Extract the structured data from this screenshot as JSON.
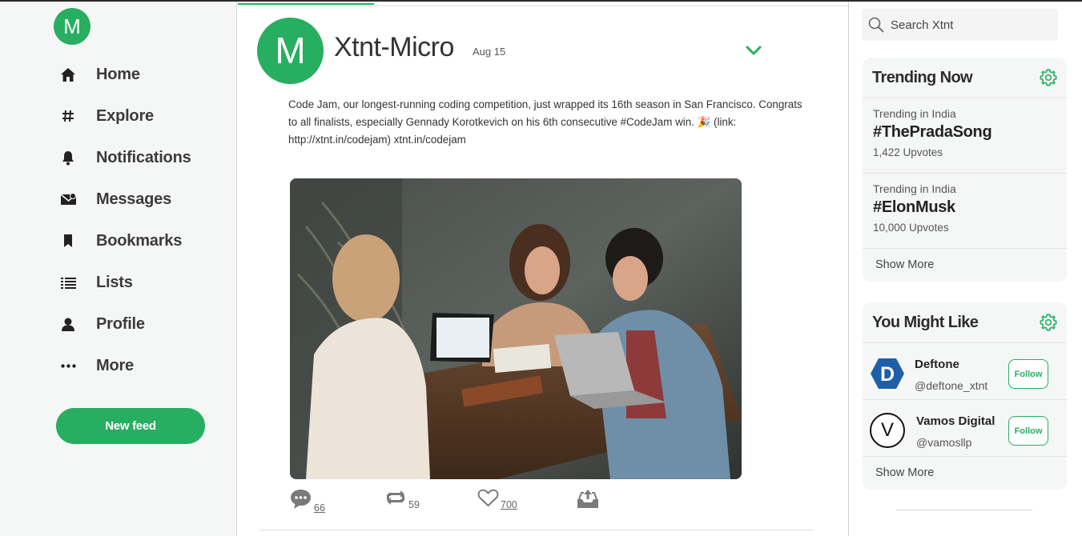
{
  "brand": {
    "logo_letter": "M"
  },
  "nav": {
    "items": [
      {
        "label": "Home",
        "icon": "home-icon"
      },
      {
        "label": "Explore",
        "icon": "hash-icon"
      },
      {
        "label": "Notifications",
        "icon": "bell-icon"
      },
      {
        "label": "Messages",
        "icon": "envelope-icon"
      },
      {
        "label": "Bookmarks",
        "icon": "bookmark-icon"
      },
      {
        "label": "Lists",
        "icon": "list-icon"
      },
      {
        "label": "Profile",
        "icon": "user-icon"
      },
      {
        "label": "More",
        "icon": "ellipsis-icon"
      }
    ],
    "new_feed_label": "New feed"
  },
  "post": {
    "avatar_letter": "M",
    "author": "Xtnt-Micro",
    "date": "Aug 15",
    "text": "Code Jam, our longest-running coding competition, just wrapped its 16th season in San Francisco. Congrats to all finalists, especially Gennady Korotkevich on his 6th consecutive #CodeJam win. 🎉 (link: http://xtnt.in/codejam) xtnt.in/codejam",
    "comments": "66",
    "reposts": "59",
    "likes": "700"
  },
  "search": {
    "placeholder": "Search Xtnt"
  },
  "trending": {
    "title": "Trending Now",
    "items": [
      {
        "where": "Trending in India",
        "tag": "#ThePradaSong",
        "votes": "1,422 Upvotes"
      },
      {
        "where": "Trending in India",
        "tag": "#ElonMusk",
        "votes": "10,000 Upvotes"
      }
    ],
    "show_more": "Show More"
  },
  "suggestions": {
    "title": "You Might Like",
    "items": [
      {
        "name": "Deftone",
        "handle": "@deftone_xtnt",
        "avatar_letter": "D",
        "follow": "Follow"
      },
      {
        "name": "Vamos Digital",
        "handle": "@vamosllp",
        "avatar_letter": "V",
        "follow": "Follow"
      }
    ],
    "show_more": "Show More"
  },
  "colors": {
    "accent": "#27ae60",
    "deftone_blue": "#1f5fa8"
  }
}
